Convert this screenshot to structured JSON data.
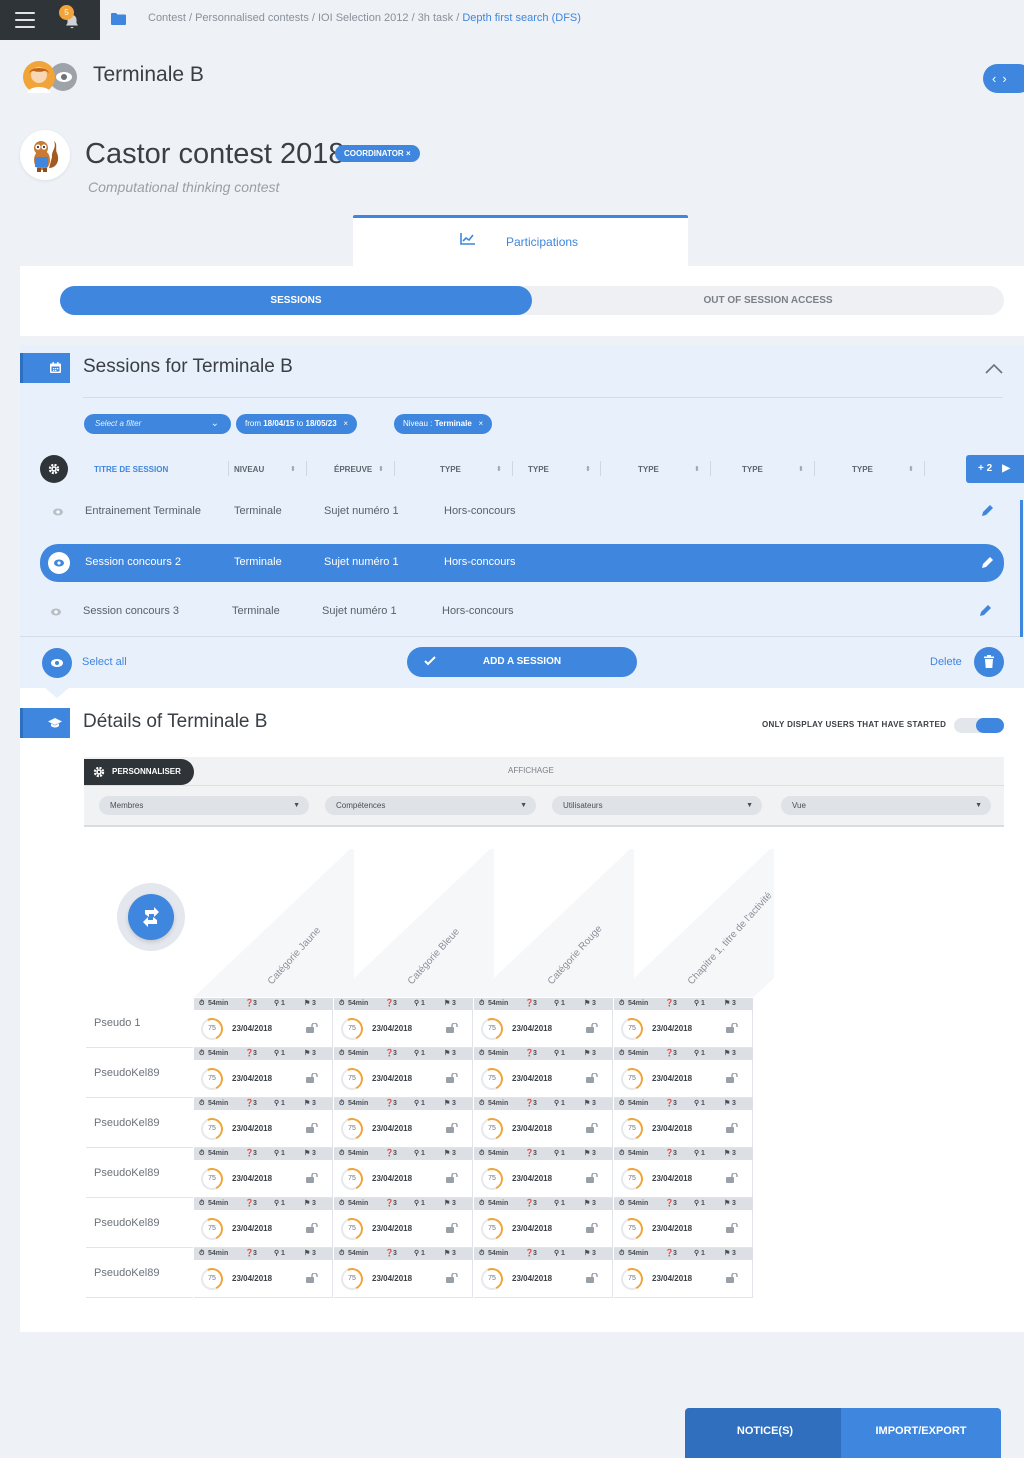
{
  "topbar": {
    "notification_count": "5",
    "breadcrumb": [
      "Contest",
      "Personnalised contests",
      "IOI Selection 2012",
      "3h task"
    ],
    "breadcrumb_current": "Depth first search (DFS)"
  },
  "group": {
    "title": "Terminale B"
  },
  "contest": {
    "title": "Castor contest 2018",
    "role": "COORDINATOR",
    "subtitle": "Computational thinking contest"
  },
  "tabs": [
    {
      "label": "Participations",
      "icon": "chart-line-icon"
    }
  ],
  "segment": {
    "sessions": "SESSIONS",
    "out_of_session": "OUT OF SESSION ACCESS"
  },
  "sessions": {
    "title": "Sessions for Terminale B",
    "filter_placeholder": "Select a filter",
    "chip_date_from": "from",
    "chip_date_start": "18/04/15",
    "chip_date_to": "to",
    "chip_date_end": "18/05/23",
    "chip_level_label": "Niveau :",
    "chip_level_value": "Terminale",
    "columns": [
      "TITRE DE SESSION",
      "NIVEAU",
      "ÉPREUVE",
      "TYPE",
      "TYPE",
      "TYPE",
      "TYPE",
      "TYPE"
    ],
    "more_columns": "+ 2",
    "rows": [
      {
        "title": "Entrainement Terminale",
        "level": "Terminale",
        "epreuve": "Sujet numéro 1",
        "type": "Hors-concours",
        "selected": false
      },
      {
        "title": "Session concours 2",
        "level": "Terminale",
        "epreuve": "Sujet numéro 1",
        "type": "Hors-concours",
        "selected": true
      },
      {
        "title": "Session concours 3",
        "level": "Terminale",
        "epreuve": "Sujet numéro 1",
        "type": "Hors-concours",
        "selected": false
      }
    ],
    "select_all": "Select all",
    "add_session": "ADD A SESSION",
    "delete": "Delete"
  },
  "details": {
    "title": "Détails of Terminale B",
    "only_started_label": "ONLY DISPLAY USERS THAT HAVE STARTED",
    "only_started_on": true,
    "personaliser": "PERSONNALISER",
    "affichage": "AFFICHAGE",
    "dropdowns": [
      "Membres",
      "Compétences",
      "Utilisateurs",
      "Vue"
    ],
    "columns": [
      "Catégorie Jaune",
      "Catégorie Bleue",
      "Catégorie Rouge",
      "Chapitre 1, titre de l'activité"
    ],
    "users": [
      "Pseudo 1",
      "PseudoKel89",
      "PseudoKel89",
      "PseudoKel89",
      "PseudoKel89",
      "PseudoKel89"
    ],
    "cell": {
      "time": "54min",
      "questions": "3",
      "hints": "1",
      "flags": "3",
      "score": "75",
      "date": "23/04/2018"
    }
  },
  "footer": {
    "notices": "NOTICE(S)",
    "import_export": "IMPORT/EXPORT"
  },
  "colors": {
    "accent": "#3f86de",
    "dark": "#2f3438",
    "progress": "#f0a43a",
    "background": "#eef1f6"
  }
}
